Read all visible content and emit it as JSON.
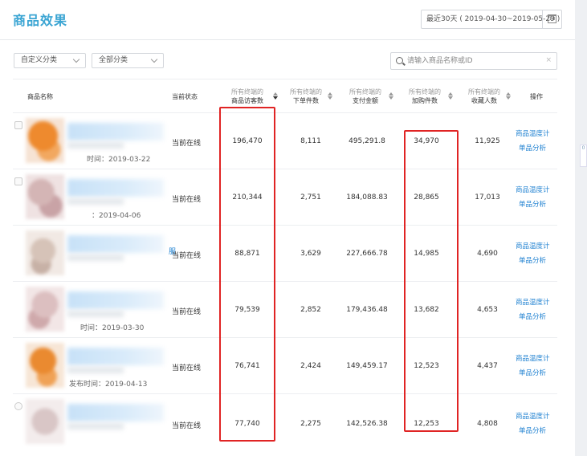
{
  "page": {
    "title": "商品效果"
  },
  "date_picker": {
    "value": "最近30天 ( 2019-04-30~2019-05-29 )",
    "icon": "calendar-icon",
    "icon_day": "18"
  },
  "filters": {
    "custom_category": "自定义分类",
    "all_category": "全部分类"
  },
  "search": {
    "placeholder": "请输入商品名称或ID",
    "clear": "×"
  },
  "table": {
    "headers": {
      "name": "商品名称",
      "status": "当前状态",
      "sub": "所有终端的",
      "visitors": "商品访客数",
      "orders": "下单件数",
      "payment": "支付金额",
      "cart": "加购件数",
      "fav": "收藏人数",
      "action": "操作"
    },
    "rows": [
      {
        "pub_date": "时间：2019-03-22",
        "status": "当前在线",
        "visitors": "196,470",
        "orders": "8,111",
        "payment": "495,291.8",
        "cart": "34,970",
        "fav": "11,925",
        "action1": "商品温度计",
        "action2": "单品分析"
      },
      {
        "pub_date": "：2019-04-06",
        "status": "当前在线",
        "visitors": "210,344",
        "orders": "2,751",
        "payment": "184,088.83",
        "cart": "28,865",
        "fav": "17,013",
        "action1": "商品温度计",
        "action2": "单品分析"
      },
      {
        "pub_date": "",
        "status": "当前在线",
        "visitors": "88,871",
        "orders": "3,629",
        "payment": "227,666.78",
        "cart": "14,985",
        "fav": "4,690",
        "action1": "商品温度计",
        "action2": "单品分析"
      },
      {
        "pub_date": "时间：2019-03-30",
        "status": "当前在线",
        "visitors": "79,539",
        "orders": "2,852",
        "payment": "179,436.48",
        "cart": "13,682",
        "fav": "4,653",
        "action1": "商品温度计",
        "action2": "单品分析"
      },
      {
        "pub_date": "发布时间：2019-04-13",
        "status": "当前在线",
        "visitors": "76,741",
        "orders": "2,424",
        "payment": "149,459.17",
        "cart": "12,523",
        "fav": "4,437",
        "action1": "商品温度计",
        "action2": "单品分析"
      },
      {
        "pub_date": "",
        "status": "当前在线",
        "visitors": "77,740",
        "orders": "2,275",
        "payment": "142,526.38",
        "cart": "12,253",
        "fav": "4,808",
        "action1": "商品温度计",
        "action2": "单品分析"
      }
    ]
  },
  "misc": {
    "row3_link": "服",
    "side_tab": "0"
  },
  "colors": {
    "accent": "#3ba5d3",
    "link": "#1b7fd0",
    "highlight": "#e02424"
  }
}
